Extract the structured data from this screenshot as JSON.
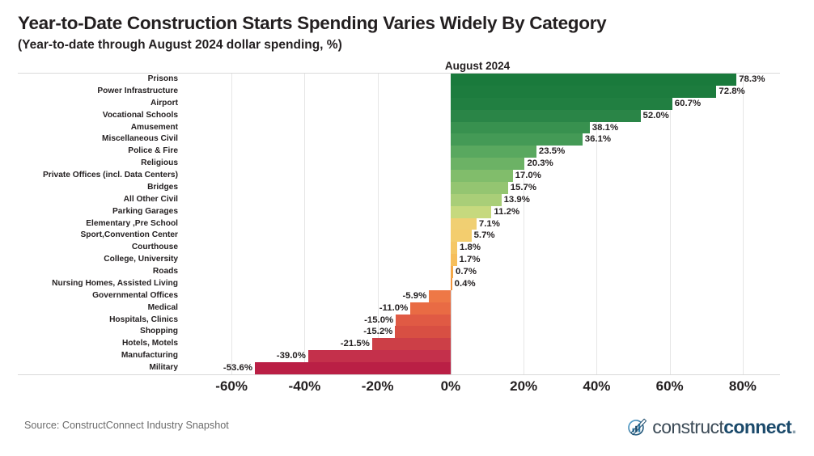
{
  "header": {
    "title": "Year-to-Date Construction Starts Spending Varies Widely By Category",
    "subtitle": "(Year-to-date through August 2024 dollar spending, %)"
  },
  "footer": {
    "source": "Source: ConstructConnect Industry Snapshot",
    "logo_mark": "constructconnect-logo-icon",
    "logo_text_light": "construct",
    "logo_text_bold": "connect",
    "logo_dot": "."
  },
  "chart_data": {
    "type": "bar",
    "orientation": "horizontal",
    "title": "Year-to-Date Construction Starts Spending Varies Widely By Category",
    "subtitle": "(Year-to-date through August 2024 dollar spending, %)",
    "series_header": "August 2024",
    "xlabel": "",
    "ylabel": "",
    "xlim": [
      -70,
      90
    ],
    "xticks": [
      -60,
      -40,
      -20,
      0,
      20,
      40,
      60,
      80
    ],
    "xtick_labels": [
      "-60%",
      "-40%",
      "-20%",
      "0%",
      "20%",
      "40%",
      "60%",
      "80%"
    ],
    "grid": true,
    "legend": "none",
    "categories": [
      "Prisons",
      "Power Infrastructure",
      "Airport",
      "Vocational Schools",
      "Amusement",
      "Miscellaneous Civil",
      "Police & Fire",
      "Religious",
      "Private Offices (incl. Data Centers)",
      "Bridges",
      "All Other Civil",
      "Parking Garages",
      "Elementary ,Pre School",
      "Sport,Convention Center",
      "Courthouse",
      "College, University",
      "Roads",
      "Nursing Homes, Assisted Living",
      "Governmental Offices",
      "Medical",
      "Hospitals, Clinics",
      "Shopping",
      "Hotels, Motels",
      "Manufacturing",
      "Military"
    ],
    "values": [
      78.3,
      72.8,
      60.7,
      52.0,
      38.1,
      36.1,
      23.5,
      20.3,
      17.0,
      15.7,
      13.9,
      11.2,
      7.1,
      5.7,
      1.8,
      1.7,
      0.7,
      0.4,
      -5.9,
      -11.0,
      -15.0,
      -15.2,
      -21.5,
      -39.0,
      -53.6
    ],
    "value_labels": [
      "78.3%",
      "72.8%",
      "60.7%",
      "52.0%",
      "38.1%",
      "36.1%",
      "23.5%",
      "20.3%",
      "17.0%",
      "15.7%",
      "13.9%",
      "11.2%",
      "7.1%",
      "5.7%",
      "1.8%",
      "1.7%",
      "0.7%",
      "0.4%",
      "-5.9%",
      "-11.0%",
      "-15.0%",
      "-15.2%",
      "-21.5%",
      "-39.0%",
      "-53.6%"
    ],
    "bar_colors": [
      "#1a7a3c",
      "#1d7c3e",
      "#217f41",
      "#2a8547",
      "#38914f",
      "#449a56",
      "#59a85f",
      "#6cb265",
      "#81bd6b",
      "#94c571",
      "#a9ce78",
      "#c6d97e",
      "#f0cf72",
      "#f3cd6e",
      "#f5c765",
      "#f6be5a",
      "#f4a94a",
      "#f2963f",
      "#ee7846",
      "#e96b44",
      "#e05a44",
      "#d84f43",
      "#cc3f47",
      "#c4304b",
      "#ba1f45"
    ],
    "positive_color_range": [
      "#1a7a3c",
      "#f0cf72"
    ],
    "negative_color_range": [
      "#f2963f",
      "#ba1f45"
    ],
    "axis_color": "#d9d9d9",
    "text_color": "#231f20"
  }
}
